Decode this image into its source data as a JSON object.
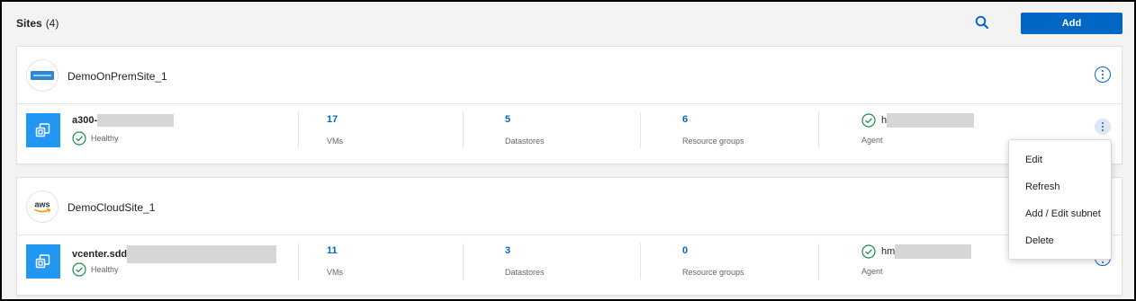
{
  "header": {
    "title": "Sites",
    "count": "(4)",
    "add_label": "Add"
  },
  "sites": [
    {
      "name": "DemoOnPremSite_1",
      "logo": "server-icon",
      "vcenter": {
        "name": "a300-",
        "status": "Healthy",
        "vms_value": "17",
        "vms_label": "VMs",
        "datastores_value": "5",
        "datastores_label": "Datastores",
        "rg_value": "6",
        "rg_label": "Resource groups",
        "agent_name": "h",
        "agent_label": "Agent"
      }
    },
    {
      "name": "DemoCloudSite_1",
      "logo": "aws",
      "vcenter": {
        "name": "vcenter.sdd",
        "status": "Healthy",
        "vms_value": "11",
        "vms_label": "VMs",
        "datastores_value": "3",
        "datastores_label": "Datastores",
        "rg_value": "0",
        "rg_label": "Resource groups",
        "agent_name": "hm",
        "agent_label": "Agent"
      }
    }
  ],
  "menu": {
    "items": [
      "Edit",
      "Refresh",
      "Add / Edit subnet",
      "Delete"
    ]
  },
  "colors": {
    "accent": "#0067c5",
    "vcenter_tile": "#2196f3",
    "healthy": "#1e8a4f"
  }
}
